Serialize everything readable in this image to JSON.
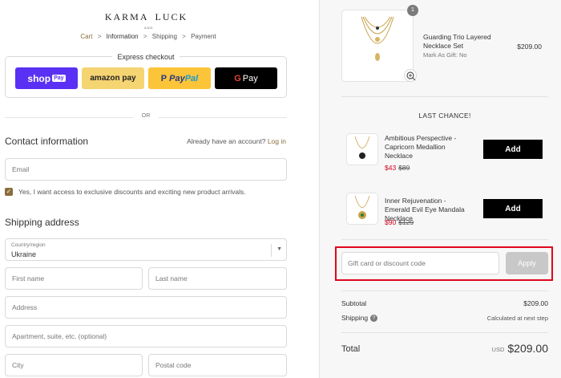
{
  "brand": {
    "logo_left": "KARMA",
    "logo_right": "LUCK",
    "logo_sub": "AND"
  },
  "breadcrumb": {
    "items": [
      "Cart",
      "Information",
      "Shipping",
      "Payment"
    ],
    "sep": ">"
  },
  "express": {
    "title": "Express checkout",
    "shoppay": "shop",
    "shoppay_box": "Pay",
    "amazon": "amazon pay",
    "paypal_a": "Pay",
    "paypal_b": "Pal",
    "gpay_g": "G",
    "gpay": "Pay"
  },
  "or": "OR",
  "contact": {
    "title": "Contact information",
    "account_prompt": "Already have an account?",
    "login": "Log in",
    "email_placeholder": "Email",
    "newsletter_label": "Yes, I want access to exclusive discounts and exciting new product arrivals."
  },
  "shipping": {
    "title": "Shipping address",
    "country_label": "Country/region",
    "country_value": "Ukraine",
    "first_name": "First name",
    "last_name": "Last name",
    "address": "Address",
    "apartment": "Apartment, suite, etc. (optional)",
    "city": "City",
    "postal": "Postal code"
  },
  "cart": {
    "quantity": "1",
    "product_name": "Guarding Trio Layered Necklace Set",
    "product_sub": "Mark As Gift: No",
    "product_price": "$209.00"
  },
  "upsell": {
    "title": "LAST CHANCE!",
    "items": [
      {
        "name": "Ambitious Perspective - Capricorn Medallion Necklace",
        "sale": "$43",
        "original": "$89",
        "button": "Add"
      },
      {
        "name": "Inner Rejuvenation - Emerald Evil Eye Mandala Necklace",
        "sale": "$90",
        "original": "$129",
        "button": "Add"
      }
    ]
  },
  "discount": {
    "placeholder": "Gift card or discount code",
    "button": "Apply"
  },
  "summary": {
    "subtotal_label": "Subtotal",
    "subtotal": "$209.00",
    "shipping_label": "Shipping",
    "shipping_value": "Calculated at next step",
    "total_label": "Total",
    "currency": "USD",
    "total": "$209.00"
  },
  "colors": {
    "accent": "#8a6d3b",
    "highlight": "#e0061d",
    "sale": "#d0021b",
    "shoppay": "#5a31f4"
  }
}
